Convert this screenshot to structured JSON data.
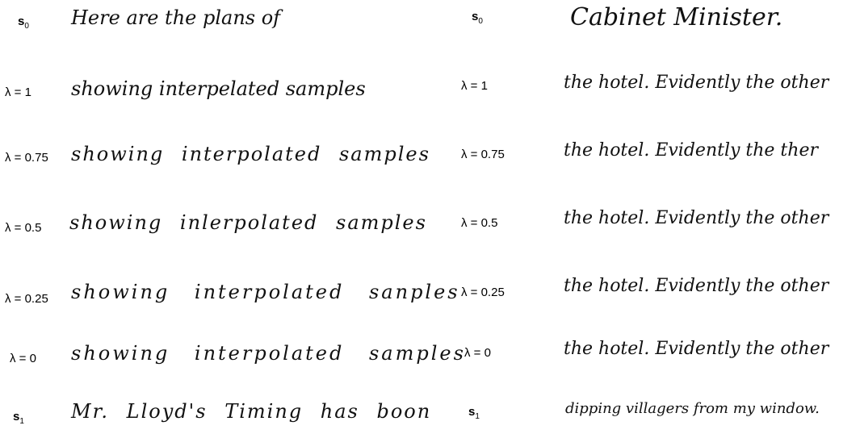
{
  "left": {
    "rows": [
      {
        "label": "s",
        "sub": "0",
        "text": "Here are the plans of"
      },
      {
        "label": "λ = 1",
        "sub": "",
        "text": "showing interpelated samples"
      },
      {
        "label": "λ = 0.75",
        "sub": "",
        "text": "showing interpolated samples"
      },
      {
        "label": "λ = 0.5",
        "sub": "",
        "text": "showing inlerpolated samples"
      },
      {
        "label": "λ = 0.25",
        "sub": "",
        "text": "showing interpolated sanples"
      },
      {
        "label": "λ = 0",
        "sub": "",
        "text": "showing interpolated samples"
      },
      {
        "label": "s",
        "sub": "1",
        "text": "Mr. Lloyd's Timing has boon"
      }
    ]
  },
  "right": {
    "rows": [
      {
        "label": "s",
        "sub": "0",
        "text": "Cabinet Minister."
      },
      {
        "label": "λ = 1",
        "sub": "",
        "text": "the hotel. Evidently the other"
      },
      {
        "label": "λ = 0.75",
        "sub": "",
        "text": "the hotel. Evidently the ther"
      },
      {
        "label": "λ = 0.5",
        "sub": "",
        "text": "the hotel. Evidently the other"
      },
      {
        "label": "λ = 0.25",
        "sub": "",
        "text": "the hotel. Evidently the other"
      },
      {
        "label": "λ = 0",
        "sub": "",
        "text": "the hotel. Evidently the other"
      },
      {
        "label": "s",
        "sub": "1",
        "text": "dipping villagers from my window."
      }
    ]
  }
}
